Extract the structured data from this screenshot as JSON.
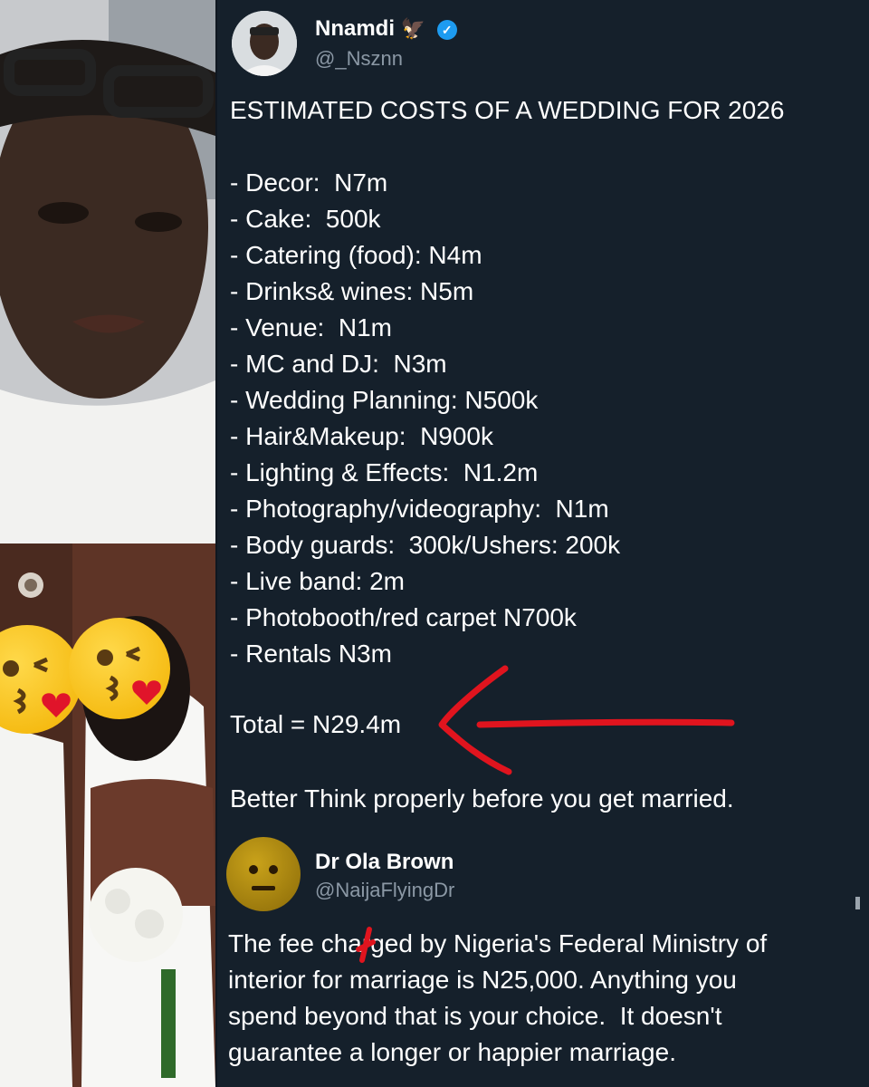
{
  "tweet1": {
    "author_name": "Nnamdi",
    "author_handle": "@_Nsznn",
    "title": "ESTIMATED COSTS OF A WEDDING FOR 2026",
    "items": [
      "- Decor:  N7m",
      "- Cake:  500k",
      "- Catering (food): N4m",
      "- Drinks& wines: N5m",
      "- Venue:  N1m",
      "- MC and DJ:  N3m",
      "- Wedding Planning: N500k",
      "- Hair&Makeup:  N900k",
      "- Lighting & Effects:  N1.2m",
      "- Photography/videography:  N1m",
      "- Body guards:  300k/Ushers: 200k",
      "- Live band: 2m",
      "- Photobooth/red carpet N700k",
      "- Rentals N3m"
    ],
    "total": "Total = N29.4m",
    "closing": "Better Think properly before you get married."
  },
  "tweet2": {
    "author_name": "Dr Ola Brown",
    "author_handle": "@NaijaFlyingDr",
    "body_lines": [
      "The fee charged by Nigeria's Federal Ministry of",
      "interior for marriage is N25,000. Anything you",
      "spend beyond that is your choice.  It doesn't",
      "guarantee a longer or happier marriage."
    ]
  },
  "icons": {
    "verified": "verified-badge-icon",
    "eagle": "eagle-emoji-icon",
    "kiss1": "kissing-face-emoji-icon",
    "kiss2": "kissing-face-emoji-icon",
    "neutral": "neutral-face-emoji-icon"
  },
  "colors": {
    "background": "#15202b",
    "text": "#ffffff",
    "handle": "#8b98a5",
    "verified": "#1d9bf0",
    "annotation": "#e0141e"
  }
}
